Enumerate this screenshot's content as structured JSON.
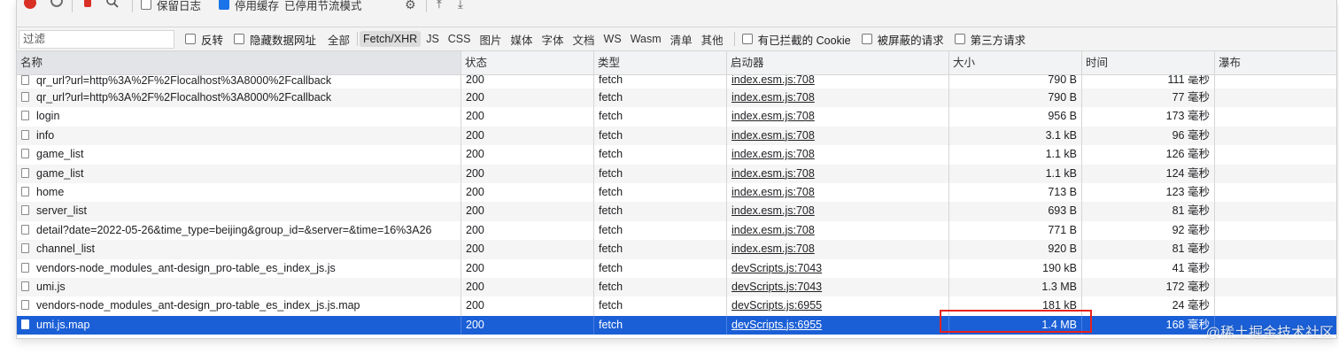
{
  "toolbar": {
    "preserve_log_label": "保留日志",
    "disable_cache_label": "停用缓存",
    "throttle_label": "已停用节流模式"
  },
  "filterbar": {
    "filter_placeholder": "过滤",
    "invert_label": "反转",
    "hide_data_urls_label": "隐藏数据网址",
    "types": [
      "全部",
      "Fetch/XHR",
      "JS",
      "CSS",
      "图片",
      "媒体",
      "字体",
      "文档",
      "WS",
      "Wasm",
      "清单",
      "其他"
    ],
    "active_type": "Fetch/XHR",
    "blocked_cookies_label": "有已拦截的 Cookie",
    "blocked_requests_label": "被屏蔽的请求",
    "third_party_label": "第三方请求"
  },
  "table": {
    "headers": {
      "name": "名称",
      "status": "状态",
      "type": "类型",
      "initiator": "启动器",
      "size": "大小",
      "time": "时间",
      "waterfall": "瀑布"
    },
    "rows": [
      {
        "name": "qr_url?url=http%3A%2F%2Flocalhost%3A8000%2Fcallback",
        "status": "200",
        "type": "fetch",
        "initiator": "index.esm.js:708",
        "size": "790 B",
        "time": "111 毫秒"
      },
      {
        "name": "qr_url?url=http%3A%2F%2Flocalhost%3A8000%2Fcallback",
        "status": "200",
        "type": "fetch",
        "initiator": "index.esm.js:708",
        "size": "790 B",
        "time": "77 毫秒"
      },
      {
        "name": "login",
        "status": "200",
        "type": "fetch",
        "initiator": "index.esm.js:708",
        "size": "956 B",
        "time": "173 毫秒"
      },
      {
        "name": "info",
        "status": "200",
        "type": "fetch",
        "initiator": "index.esm.js:708",
        "size": "3.1 kB",
        "time": "96 毫秒"
      },
      {
        "name": "game_list",
        "status": "200",
        "type": "fetch",
        "initiator": "index.esm.js:708",
        "size": "1.1 kB",
        "time": "126 毫秒"
      },
      {
        "name": "game_list",
        "status": "200",
        "type": "fetch",
        "initiator": "index.esm.js:708",
        "size": "1.1 kB",
        "time": "124 毫秒"
      },
      {
        "name": "home",
        "status": "200",
        "type": "fetch",
        "initiator": "index.esm.js:708",
        "size": "713 B",
        "time": "123 毫秒"
      },
      {
        "name": "server_list",
        "status": "200",
        "type": "fetch",
        "initiator": "index.esm.js:708",
        "size": "693 B",
        "time": "81 毫秒"
      },
      {
        "name": "detail?date=2022-05-26&time_type=beijing&group_id=&server=&time=16%3A26",
        "status": "200",
        "type": "fetch",
        "initiator": "index.esm.js:708",
        "size": "771 B",
        "time": "92 毫秒"
      },
      {
        "name": "channel_list",
        "status": "200",
        "type": "fetch",
        "initiator": "index.esm.js:708",
        "size": "920 B",
        "time": "81 毫秒"
      },
      {
        "name": "vendors-node_modules_ant-design_pro-table_es_index_js.js",
        "status": "200",
        "type": "fetch",
        "initiator": "devScripts.js:7043",
        "size": "190 kB",
        "time": "41 毫秒"
      },
      {
        "name": "umi.js",
        "status": "200",
        "type": "fetch",
        "initiator": "devScripts.js:7043",
        "size": "1.3 MB",
        "time": "172 毫秒"
      },
      {
        "name": "vendors-node_modules_ant-design_pro-table_es_index_js.js.map",
        "status": "200",
        "type": "fetch",
        "initiator": "devScripts.js:6955",
        "size": "181 kB",
        "time": "24 毫秒"
      },
      {
        "name": "umi.js.map",
        "status": "200",
        "type": "fetch",
        "initiator": "devScripts.js:6955",
        "size": "1.4 MB",
        "time": "168 毫秒"
      }
    ],
    "selected_index": 13
  },
  "watermark": "@稀土掘金技术社区",
  "colors": {
    "selected_row": "#1a5fd6",
    "highlight_box": "#e8231d",
    "active_filter": "#dcdcdc"
  }
}
